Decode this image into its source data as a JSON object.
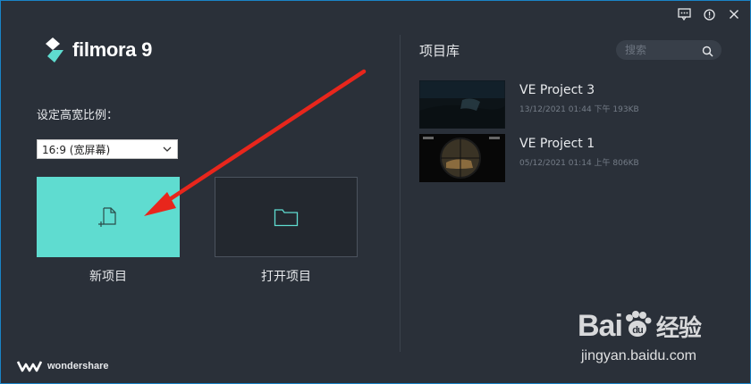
{
  "app": {
    "logo_text": "filmora",
    "logo_version": "9",
    "brand_text": "wondershare"
  },
  "titlebar": {
    "icons": [
      "feedback-icon",
      "info-icon",
      "close-icon"
    ]
  },
  "left_panel": {
    "ratio_label": "设定高宽比例：",
    "ratio_selected": "16:9 (宽屏幕)",
    "new_project_label": "新项目",
    "open_project_label": "打开项目"
  },
  "library": {
    "title": "项目库",
    "search_placeholder": "搜索",
    "projects": [
      {
        "name": "VE Project 3",
        "meta": "13/12/2021 01:44 下午 193KB"
      },
      {
        "name": "VE Project 1",
        "meta": "05/12/2021 01:14 上午 806KB"
      }
    ]
  },
  "watermark": {
    "main_a": "Bai",
    "main_b": "经验",
    "sub": "jingyan.baidu.com"
  },
  "colors": {
    "accent": "#5fdcd0",
    "background": "#2a3039",
    "annotation_arrow": "#e8261c",
    "window_border": "#1a84c7"
  }
}
